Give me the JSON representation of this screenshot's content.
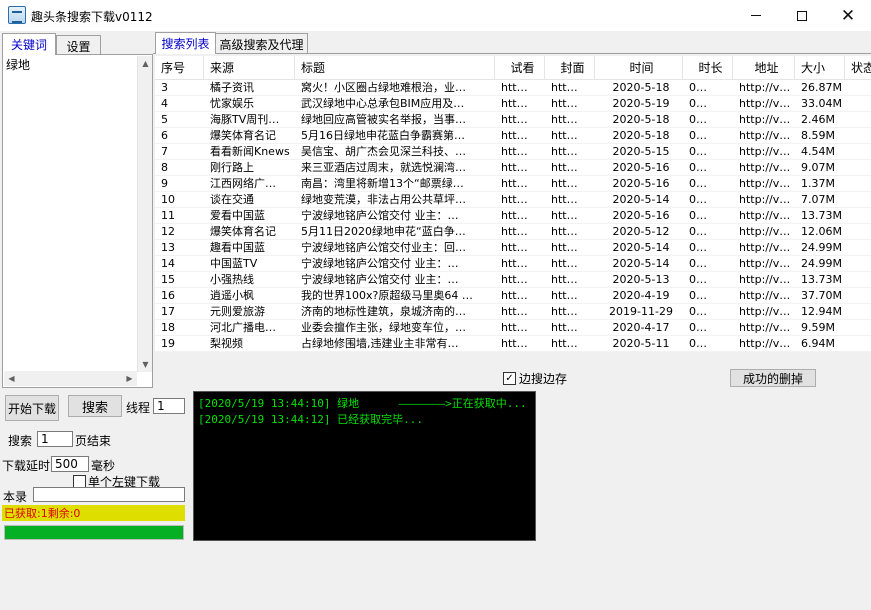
{
  "window": {
    "title": "趣头条搜索下载v0112",
    "minimize_glyph": "",
    "close_glyph": "✕"
  },
  "left_tabs": {
    "keyword": "关键词",
    "settings": "设置"
  },
  "keywords": [
    "绿地"
  ],
  "right_tabs": {
    "list": "搜索列表",
    "advanced": "高级搜索及代理"
  },
  "table": {
    "columns": [
      "序号",
      "来源",
      "标题",
      "试看",
      "封面",
      "时间",
      "时长",
      "地址",
      "大小",
      "状态"
    ],
    "rows": [
      [
        "3",
        "橘子资讯",
        "窝火！小区圈占绿地难根治，业…",
        "htt…",
        "htt…",
        "2020-5-18",
        "0…",
        "http://v…",
        "26.87M",
        ""
      ],
      [
        "4",
        "忧家娱乐",
        "武汉绿地中心总承包BIM应用及…",
        "htt…",
        "htt…",
        "2020-5-19",
        "0…",
        "http://v…",
        "33.04M",
        ""
      ],
      [
        "5",
        "海豚TV周刊…",
        "绿地回应高管被实名举报，当事…",
        "htt…",
        "htt…",
        "2020-5-18",
        "0…",
        "http://v…",
        "2.46M",
        ""
      ],
      [
        "6",
        "爆笑体育名记",
        "5月16日绿地申花蓝白争霸赛第…",
        "htt…",
        "htt…",
        "2020-5-18",
        "0…",
        "http://v…",
        "8.59M",
        ""
      ],
      [
        "7",
        "看看新闻Knews",
        "吴信宝、胡广杰会见深兰科技、…",
        "htt…",
        "htt…",
        "2020-5-15",
        "0…",
        "http://v…",
        "4.54M",
        ""
      ],
      [
        "8",
        "刚行路上",
        "来三亚酒店过周末，就选悦澜湾…",
        "htt…",
        "htt…",
        "2020-5-16",
        "0…",
        "http://v…",
        "9.07M",
        ""
      ],
      [
        "9",
        "江西网络广…",
        "南昌：湾里将新增13个“邮票绿…",
        "htt…",
        "htt…",
        "2020-5-16",
        "0…",
        "http://v…",
        "1.37M",
        ""
      ],
      [
        "10",
        "谈在交通",
        "绿地变荒漠，非法占用公共草坪…",
        "htt…",
        "htt…",
        "2020-5-14",
        "0…",
        "http://v…",
        "7.07M",
        ""
      ],
      [
        "11",
        "爱看中国蓝",
        "宁波绿地铭庐公馆交付 业主：…",
        "htt…",
        "htt…",
        "2020-5-16",
        "0…",
        "http://v…",
        "13.73M",
        ""
      ],
      [
        "12",
        "爆笑体育名记",
        "5月11日2020绿地申花“蓝白争…",
        "htt…",
        "htt…",
        "2020-5-12",
        "0…",
        "http://v…",
        "12.06M",
        ""
      ],
      [
        "13",
        "趣看中国蓝",
        "宁波绿地铭庐公馆交付业主：回…",
        "htt…",
        "htt…",
        "2020-5-14",
        "0…",
        "http://v…",
        "24.99M",
        ""
      ],
      [
        "14",
        "中国蓝TV",
        "宁波绿地铭庐公馆交付 业主：…",
        "htt…",
        "htt…",
        "2020-5-14",
        "0…",
        "http://v…",
        "24.99M",
        ""
      ],
      [
        "15",
        "小强热线",
        "宁波绿地铭庐公馆交付 业主：…",
        "htt…",
        "htt…",
        "2020-5-13",
        "0…",
        "http://v…",
        "13.73M",
        ""
      ],
      [
        "16",
        "逍遥小枫",
        "我的世界100x?原超级马里奥64 …",
        "htt…",
        "htt…",
        "2020-4-19",
        "0…",
        "http://v…",
        "37.70M",
        ""
      ],
      [
        "17",
        "元则爱旅游",
        "济南的地标性建筑，泉城济南的…",
        "htt…",
        "htt…",
        "2019-11-29",
        "0…",
        "http://v…",
        "12.94M",
        ""
      ],
      [
        "18",
        "河北广播电…",
        "业委会擅作主张，绿地变车位，…",
        "htt…",
        "htt…",
        "2020-4-17",
        "0…",
        "http://v…",
        "9.59M",
        ""
      ],
      [
        "19",
        "梨视频",
        "占绿地修围墙,违建业主非常有…",
        "htt…",
        "htt…",
        "2020-5-11",
        "0…",
        "http://v…",
        "6.94M",
        ""
      ]
    ]
  },
  "options": {
    "search_while_saving": "边搜边存",
    "search_while_saving_checked": true,
    "delete_success": "成功的删掉"
  },
  "controls": {
    "start_download": "开始下载",
    "search": "搜索",
    "threads_label": "线程",
    "threads_value": "1",
    "search_label": "搜索",
    "pages_value": "1",
    "page_end_label": "页结束",
    "delay_label": "下载延时",
    "delay_value": "500",
    "ms_label": "毫秒",
    "single_left_click": "单个左键下载",
    "single_left_click_checked": false,
    "save_dir_label": "本录",
    "save_dir_value": ""
  },
  "log": {
    "lines": [
      "[2020/5/19 13:44:10] 绿地      ———————>正在获取中...",
      "[2020/5/19 13:44:12] 已经获取完毕..."
    ]
  },
  "status": {
    "text": "已获取:1剩余:0",
    "progress": 1.0
  }
}
